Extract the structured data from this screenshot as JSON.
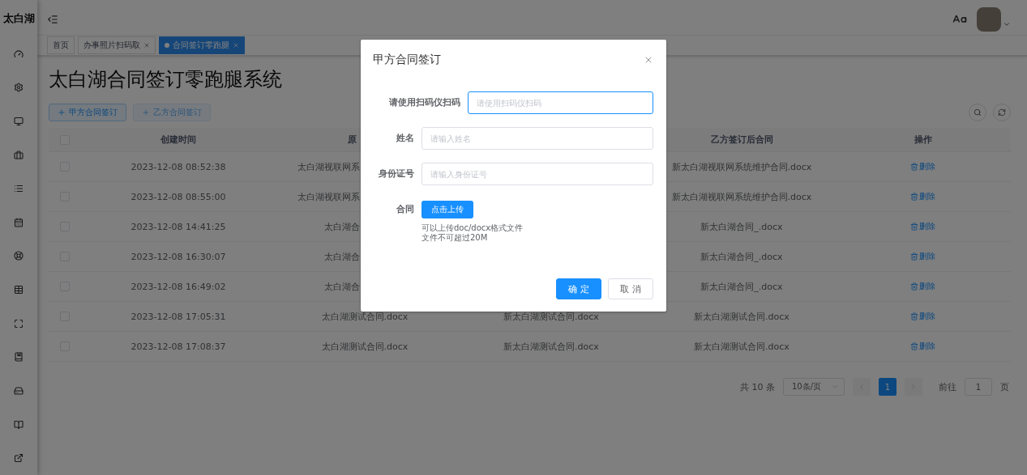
{
  "sidebar": {
    "title": "太白湖"
  },
  "tabs": [
    {
      "label": "首页",
      "selected": false,
      "closable": false
    },
    {
      "label": "办事照片扫码取",
      "selected": false,
      "closable": true
    },
    {
      "label": "合同签订零跑腿",
      "selected": true,
      "closable": true
    }
  ],
  "page_title": "太白湖合同签订零跑腿系统",
  "toolbar_buttons": [
    {
      "label": "甲方合同签订",
      "disabled": false
    },
    {
      "label": "乙方合同签订",
      "disabled": true
    }
  ],
  "table": {
    "header_checked": false,
    "columns": [
      {
        "label": "创建时间",
        "clipped": false
      },
      {
        "label": "原",
        "clipped": true
      },
      {
        "label": "乙方签订后合同",
        "clipped": false
      },
      {
        "label": "操作",
        "clipped": false
      }
    ],
    "rows": [
      {
        "checked": false,
        "created": "2023-12-08 08:52:38",
        "original": {
          "text": "太白湖视联网系",
          "clipped": true
        },
        "party_b": "新太白湖视联网系统维护合同.docx",
        "action": "删除"
      },
      {
        "checked": false,
        "created": "2023-12-08 08:55:00",
        "original": {
          "text": "太白湖视联网系",
          "clipped": true
        },
        "party_b": "新太白湖视联网系统维护合同.docx",
        "action": "删除"
      },
      {
        "checked": false,
        "created": "2023-12-08 14:41:25",
        "original": {
          "text": "太白湖合",
          "clipped": true
        },
        "party_b": "新太白湖合同_.docx",
        "action": "删除"
      },
      {
        "checked": false,
        "created": "2023-12-08 16:30:07",
        "original": {
          "text": "太白湖合",
          "clipped": true
        },
        "party_b": "新太白湖合同_.docx",
        "action": "删除"
      },
      {
        "checked": false,
        "created": "2023-12-08 16:49:02",
        "original": {
          "text": "太白湖合",
          "clipped": true
        },
        "party_b": "新太白湖合同_.docx",
        "action": "删除"
      },
      {
        "checked": false,
        "created": "2023-12-08 17:05:31",
        "original": {
          "text": "太白湖测试合同.docx",
          "clipped": false
        },
        "column_3": "新太白湖测试合同.docx",
        "party_b": "新太白湖测试合同.docx",
        "action": "删除"
      },
      {
        "checked": false,
        "created": "2023-12-08 17:08:37",
        "original": {
          "text": "太白湖测试合同.docx",
          "clipped": false
        },
        "column_3": "新太白湖测试合同.docx",
        "party_b": "新太白湖测试合同.docx",
        "action": "删除"
      }
    ]
  },
  "pagination": {
    "total": "共 10 条",
    "page_size": "10条/页",
    "pages": [
      {
        "label": "1",
        "selected": true
      }
    ],
    "goto_label": "前往",
    "goto_value": "1",
    "goto_suffix": "页"
  },
  "dialog": {
    "title": "甲方合同签订",
    "fields": [
      {
        "label": "请使用扫码仪扫码",
        "placeholder": "请使用扫码仪扫码",
        "focused": true
      },
      {
        "label": "姓名",
        "placeholder": "请输入姓名",
        "focused": false
      },
      {
        "label": "身份证号",
        "placeholder": "请输入身份证号",
        "focused": false
      }
    ],
    "upload": {
      "label": "合同",
      "button": "点击上传",
      "tips": [
        "可以上传doc/docx格式文件",
        "文件不可超过20M"
      ]
    },
    "buttons": [
      {
        "label": "确 定",
        "kind": "primary"
      },
      {
        "label": "取 消",
        "kind": "default"
      }
    ]
  }
}
